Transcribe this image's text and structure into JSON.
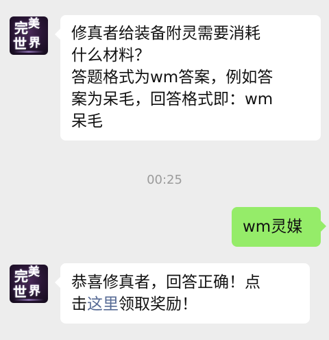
{
  "messages": [
    {
      "side": "left",
      "avatar": {
        "icon": "game-logo-avatar",
        "glyphs": [
          "完",
          "美",
          "世",
          "界"
        ]
      },
      "lines": [
        "修真者给装备附灵需要消耗",
        "什么材料？",
        "答题格式为wm答案，例如答",
        "案为呆毛，回答格式即：wm",
        "呆毛"
      ]
    },
    {
      "side": "right",
      "text": "wm灵媒"
    },
    {
      "side": "left",
      "avatar": {
        "icon": "game-logo-avatar",
        "glyphs": [
          "完",
          "美",
          "世",
          "界"
        ]
      },
      "line1": "恭喜修真者，回答正确！点",
      "line2_pre": "击",
      "line2_link": "这里",
      "line2_post": "领取奖励！"
    }
  ],
  "timestamp": "00:25",
  "colors": {
    "background": "#ededed",
    "bubble_left": "#ffffff",
    "bubble_right": "#95ec69",
    "link": "#576b95",
    "timestamp": "#9b9b9b"
  }
}
